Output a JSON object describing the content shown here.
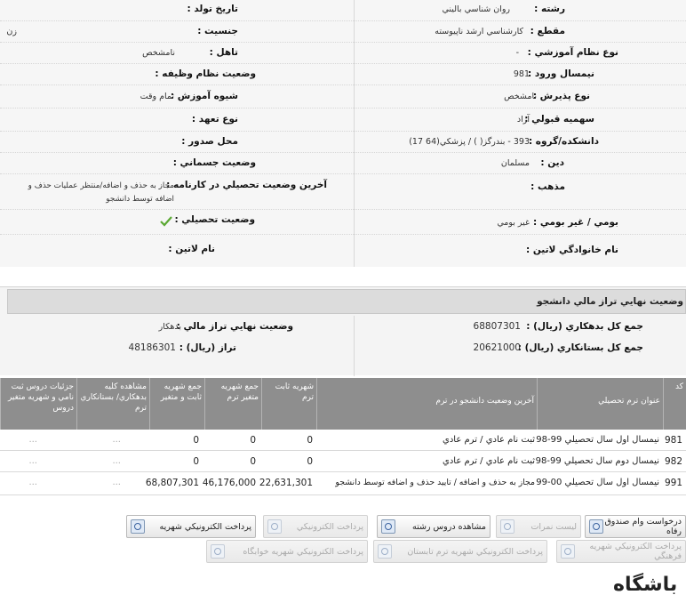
{
  "profile": {
    "right": [
      {
        "label": "رشته :",
        "value": "روان شناسي باليني"
      },
      {
        "label": "مقطع :",
        "value": "کارشناسي ارشد ناپيوسته"
      },
      {
        "label": "نوع نظام آموزشي :",
        "value": "-"
      },
      {
        "label": "نيمسال ورود :",
        "value": "981"
      },
      {
        "label": "نوع پذيرش :",
        "value": "نامشخص"
      },
      {
        "label": "سهميه قبولي :",
        "value": "آزاد"
      },
      {
        "label": "دانشکده/گروه :",
        "value": "393 - بندرگز(     ) / پزشکي(64        17)"
      },
      {
        "label": "دين :",
        "value": "مسلمان"
      },
      {
        "label": "مذهب :",
        "value": ""
      },
      {
        "label": "بومي / غير بومي :",
        "value": "غير بومي"
      },
      {
        "label": "نام خانوادگي لاتين :",
        "value": ""
      }
    ],
    "left": [
      {
        "label": "تاريخ تولد :",
        "value": ""
      },
      {
        "label": "جنسيت :",
        "value": "زن"
      },
      {
        "label": "تاهل :",
        "value": "نامشخص"
      },
      {
        "label": "وضعيت نظام وظيفه :",
        "value": ""
      },
      {
        "label": "شيوه آموزش :",
        "value": "تمام وقت"
      },
      {
        "label": "نوع تعهد :",
        "value": ""
      },
      {
        "label": "محل صدور :",
        "value": ""
      },
      {
        "label": "وضعيت جسماني :",
        "value": ""
      },
      {
        "label": "آخرين وضعيت تحصيلي در کارنامه :",
        "value": "مجاز به حذف و اضافه/منتظر عمليات حذف و",
        "value2": "اضافه توسط دانشجو"
      },
      {
        "label": "وضعيت تحصيلي :",
        "value": ""
      },
      {
        "label": "نام لاتين :",
        "value": ""
      }
    ]
  },
  "finance": {
    "title": "وضعيت نهايي تراز مالي دانشجو",
    "debit_label": "جمع کل بدهکاري (ريال) :",
    "debit_value": "68807301",
    "credit_label": "جمع کل بستانکاري (ريال) :",
    "credit_value": "20621000",
    "status_label": "وضعيت نهايي تراز مالي :",
    "status_value": "بدهکار",
    "balance_label": "تراز (ريال) :",
    "balance_value": "48186301"
  },
  "table": {
    "headers": [
      "کد",
      "عنوان ترم تحصيلي",
      "آخرين وضعيت دانشجو در ترم",
      "شهريه ثابت ترم",
      "جمع شهريه متغير ترم",
      "جمع شهريه ثابت و متغير",
      "مشاهده کليه بدهکاري/ بستانکاري ترم",
      "جزئيات دروس ثبت نامي و شهريه متغير دروس"
    ],
    "rows": [
      {
        "code": "981",
        "term": "نيمسال اول سال تحصيلي 99-98",
        "status": "ثبت نام عادي / ترم عادي",
        "fixed": "0",
        "variable": "0",
        "total": "0",
        "view": "...",
        "details": "..."
      },
      {
        "code": "982",
        "term": "نيمسال دوم سال تحصيلي 99-98",
        "status": "ثبت نام عادي / ترم عادي",
        "fixed": "0",
        "variable": "0",
        "total": "0",
        "view": "...",
        "details": "..."
      },
      {
        "code": "991",
        "term": "نيمسال اول سال تحصيلي 00-99",
        "status": "مجاز به حذف و اضافه / تاييد حذف و اضافه توسط دانشجو",
        "fixed": "22,631,301",
        "variable": "46,176,000",
        "total": "68,807,301",
        "view": "...",
        "details": "..."
      }
    ]
  },
  "buttons": {
    "loan": "درخواست وام صندوق رفاه",
    "grades": "ليست نمرات",
    "courses": "مشاهده دروس رشته",
    "epay_disabled": "پرداخت الکترونيکي",
    "epay_tuition": "پرداخت الکترونيکي شهريه",
    "cultural": "پرداخت الکترونيکي شهريه فرهنگي",
    "summer": "پرداخت الکترونيکي شهريه ترم تابستان",
    "dorm": "پرداخت الکترونيکي شهريه خوابگاه"
  },
  "watermark": "باشگاه"
}
